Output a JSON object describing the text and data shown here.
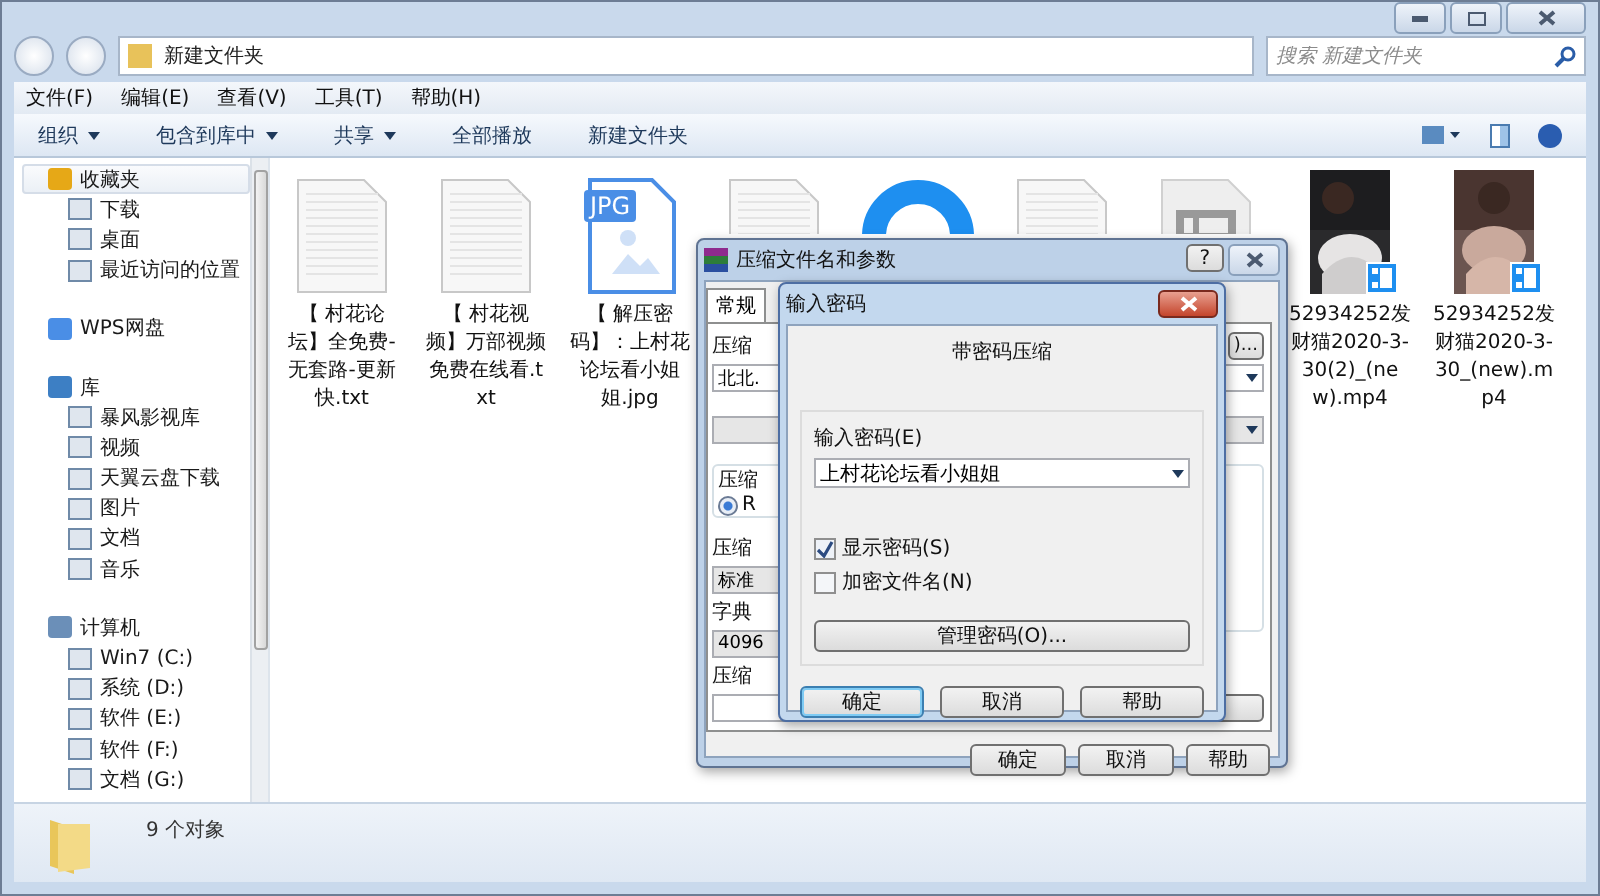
{
  "address_bar": {
    "path": "新建文件夹",
    "search_placeholder": "搜索 新建文件夹"
  },
  "menu": [
    "文件(F)",
    "编辑(E)",
    "查看(V)",
    "工具(T)",
    "帮助(H)"
  ],
  "toolbar": [
    {
      "label": "组织",
      "dropdown": true
    },
    {
      "label": "包含到库中",
      "dropdown": true
    },
    {
      "label": "共享",
      "dropdown": true
    },
    {
      "label": "全部播放",
      "dropdown": false
    },
    {
      "label": "新建文件夹",
      "dropdown": false
    }
  ],
  "sidebar": [
    {
      "label": "收藏夹",
      "selected": true,
      "children": [
        {
          "label": "下载",
          "selected": false
        },
        {
          "label": "桌面",
          "selected": false
        },
        {
          "label": "最近访问的位置",
          "selected": false
        }
      ]
    },
    {
      "label": "WPS网盘",
      "selected": false
    },
    {
      "label": "库",
      "selected": false,
      "children": [
        {
          "label": "暴风影视库",
          "selected": false
        },
        {
          "label": "视频",
          "selected": false
        },
        {
          "label": "天翼云盘下载",
          "selected": false
        },
        {
          "label": "图片",
          "selected": false
        },
        {
          "label": "文档",
          "selected": false
        },
        {
          "label": "音乐",
          "selected": false
        }
      ]
    },
    {
      "label": "计算机",
      "selected": false,
      "children": [
        {
          "label": "Win7 (C:)",
          "selected": false
        },
        {
          "label": "系统 (D:)",
          "selected": false
        },
        {
          "label": "软件 (E:)",
          "selected": false
        },
        {
          "label": "软件 (F:)",
          "selected": false
        },
        {
          "label": "文档 (G:)",
          "selected": false
        }
      ]
    }
  ],
  "files": [
    {
      "kind": "txt",
      "label": "【 村花论坛】全免费-无套路-更新快.txt"
    },
    {
      "kind": "txt",
      "label": "【 村花视频】万部视频免费在线看.txt"
    },
    {
      "kind": "jpg",
      "label": "【 解压密码】：上村花论坛看小姐姐.jpg",
      "badge": "JPG"
    },
    {
      "kind": "txt"
    },
    {
      "kind": "ring"
    },
    {
      "kind": "txt"
    },
    {
      "kind": "video"
    },
    {
      "kind": "thumb",
      "label": "52934252发财猫2020-3-30(2)_(new).mp4"
    },
    {
      "kind": "thumb",
      "label": "52934252发财猫2020-3-30_(new).mp4"
    }
  ],
  "status_bar": {
    "count": "9 个对象"
  },
  "archive_dialog": {
    "title": "压缩文件名和参数",
    "help": "?",
    "tabs": [
      {
        "label": "常规",
        "selected": true
      }
    ],
    "name_label": "压缩",
    "browse_button": ")...",
    "name_value": "北北.",
    "group_label": "压缩",
    "radio": {
      "label": "R",
      "selected": true
    },
    "method_label": "压缩",
    "method_value": "标准",
    "dict_label": "字典",
    "dict_value": "4096",
    "split_label": "压缩",
    "buttons": [
      "确定",
      "取消",
      "帮助"
    ]
  },
  "password_dialog": {
    "title": "输入密码",
    "heading": "带密码压缩",
    "password_label": "输入密码(E)",
    "password_value": "上村花论坛看小姐姐",
    "options": [
      {
        "label": "显示密码(S)",
        "checked": true
      },
      {
        "label": "加密文件名(N)",
        "checked": false
      }
    ],
    "manage_button": "管理密码(O)...",
    "buttons": [
      {
        "label": "确定",
        "selected": true
      },
      {
        "label": "取消",
        "selected": false
      },
      {
        "label": "帮助",
        "selected": false
      }
    ]
  }
}
